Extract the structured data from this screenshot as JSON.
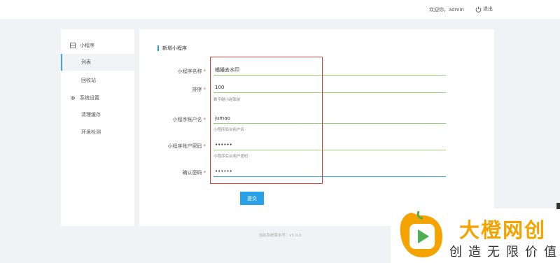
{
  "header": {
    "welcome": "欢迎你，admin",
    "logout_label": "退出"
  },
  "sidebar": {
    "groups": [
      {
        "label": "小程序",
        "icon": "list-box-icon",
        "items": [
          {
            "label": "列表",
            "active": true
          },
          {
            "label": "回收站",
            "active": false
          }
        ]
      },
      {
        "label": "系统设置",
        "icon": "gear-icon",
        "items": [
          {
            "label": "清理缓存",
            "active": false
          },
          {
            "label": "环境检测",
            "active": false
          }
        ]
      }
    ]
  },
  "form": {
    "title": "新增小程序",
    "fields": [
      {
        "label": "小程序名称",
        "value": "橘猫去水印",
        "hint": ""
      },
      {
        "label": "排序",
        "value": "100",
        "hint": "数字越小越靠前"
      },
      {
        "label": "小程序账户名",
        "value": "jumao",
        "hint": "小程序后台用户名"
      },
      {
        "label": "小程序账户密码",
        "value": "••••••",
        "hint": "小程序后台用户密码"
      },
      {
        "label": "确认密码",
        "value": "••••••",
        "hint": ""
      }
    ],
    "required_mark": "*",
    "submit_label": "提交"
  },
  "footer": {
    "version_text": "当前系统版本号：v1.0.0"
  },
  "watermark": {
    "title": "大橙网创",
    "subtitle": "创造无限价值"
  },
  "colors": {
    "accent": "#2aa1e6",
    "highlight": "#e53935",
    "valid_underline": "#9bd07e",
    "brand": "#f5a300"
  }
}
